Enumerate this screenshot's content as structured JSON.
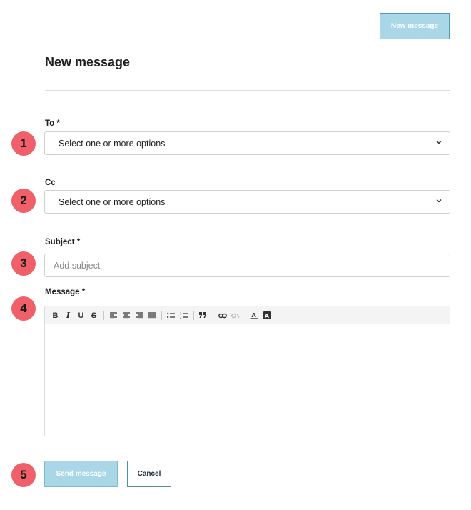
{
  "header": {
    "top_button_label": "New message",
    "title": "New message"
  },
  "form": {
    "to": {
      "label": "To *",
      "value": "Select one or more options",
      "badge": "1"
    },
    "cc": {
      "label": "Cc",
      "value": "Select one or more options",
      "badge": "2"
    },
    "subject": {
      "label": "Subject *",
      "placeholder": "Add subject",
      "value": "",
      "badge": "3"
    },
    "message": {
      "label": "Message *",
      "badge": "4",
      "toolbar": [
        "bold-icon",
        "italic-icon",
        "underline-icon",
        "strikethrough-icon",
        "align-left-icon",
        "align-center-icon",
        "align-right-icon",
        "align-justify-icon",
        "bulleted-list-icon",
        "numbered-list-icon",
        "blockquote-icon",
        "link-icon",
        "unlink-icon",
        "text-color-icon",
        "background-color-icon"
      ]
    }
  },
  "actions": {
    "send_label": "Send message",
    "cancel_label": "Cancel",
    "badge": "5"
  },
  "colors": {
    "primary_light": "#a9d7e8",
    "badge": "#f0606a",
    "border": "#cfcfcf"
  }
}
